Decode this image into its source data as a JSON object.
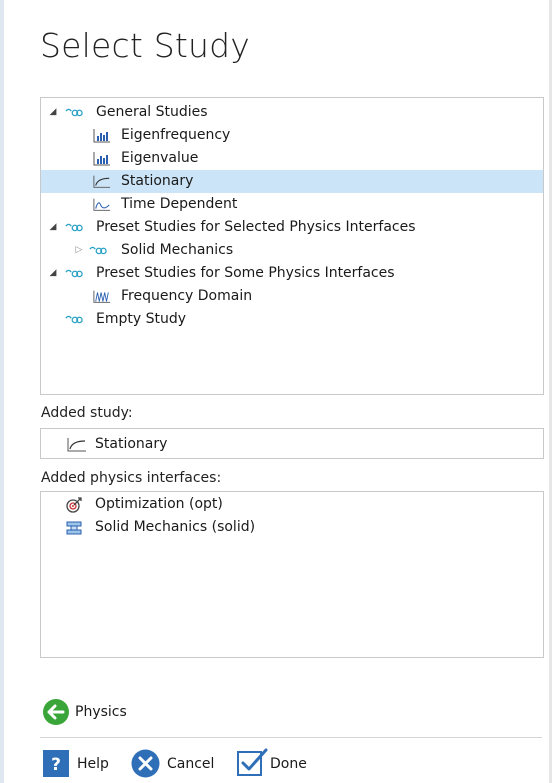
{
  "dialog": {
    "title": "Select Study"
  },
  "tree": [
    {
      "label": "General Studies",
      "icon": "study-group-icon",
      "expander": "expanded"
    },
    {
      "label": "Eigenfrequency",
      "icon": "bar-chart-icon"
    },
    {
      "label": "Eigenvalue",
      "icon": "bar-chart-icon"
    },
    {
      "label": "Stationary",
      "icon": "stationary-curve-icon",
      "selected": true
    },
    {
      "label": "Time Dependent",
      "icon": "time-dependent-icon"
    },
    {
      "label": "Preset Studies for Selected Physics Interfaces",
      "icon": "study-group-icon",
      "expander": "expanded"
    },
    {
      "label": "Solid Mechanics",
      "icon": "study-group-icon",
      "expander": "collapsed"
    },
    {
      "label": "Preset Studies for Some Physics Interfaces",
      "icon": "study-group-icon",
      "expander": "expanded"
    },
    {
      "label": "Frequency Domain",
      "icon": "frequency-domain-icon"
    },
    {
      "label": "Empty Study",
      "icon": "study-group-icon"
    }
  ],
  "added_study": {
    "heading": "Added study:",
    "item": "Stationary"
  },
  "added_physics": {
    "heading": "Added physics interfaces:",
    "items": [
      "Optimization (opt)",
      "Solid Mechanics (solid)"
    ]
  },
  "nav": {
    "back_label": "Physics"
  },
  "footer": {
    "help_label": "Help",
    "cancel_label": "Cancel",
    "done_label": "Done"
  },
  "colors": {
    "selection": "#cce4f7",
    "study_icon": "#2aa1c6",
    "back_button": "#3aa63a",
    "help_button": "#2f6fb7",
    "cancel_button": "#2f6fb7"
  }
}
